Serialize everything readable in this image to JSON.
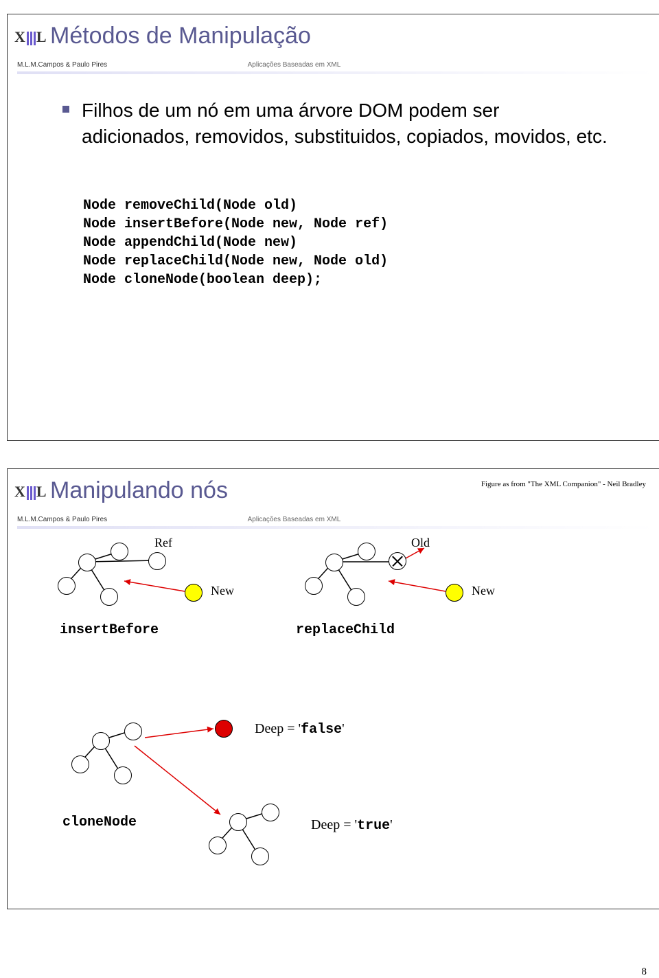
{
  "slide1": {
    "title": "Métodos de Manipulação",
    "authors": "M.L.M.Campos & Paulo Pires",
    "app": "Aplicações Baseadas em XML",
    "bullet": "Filhos de um nó em uma árvore DOM podem ser adicionados, removidos, substituidos, copiados, movidos, etc.",
    "code": "Node removeChild(Node old)\nNode insertBefore(Node new, Node ref)\nNode appendChild(Node new)\nNode replaceChild(Node new, Node old)\nNode cloneNode(boolean deep);"
  },
  "slide2": {
    "title": "Manipulando nós",
    "authors": "M.L.M.Campos & Paulo Pires",
    "app": "Aplicações Baseadas em XML",
    "fig_caption": "Figure as from \"The XML Companion\" - Neil Bradley",
    "labels": {
      "ref": "Ref",
      "old": "Old",
      "new1": "New",
      "new2": "New",
      "insertBefore": "insertBefore",
      "replaceChild": "replaceChild",
      "deep_false": "Deep = 'false'",
      "deep_true": "Deep = 'true'",
      "cloneNode": "cloneNode"
    }
  },
  "page_number": "8"
}
